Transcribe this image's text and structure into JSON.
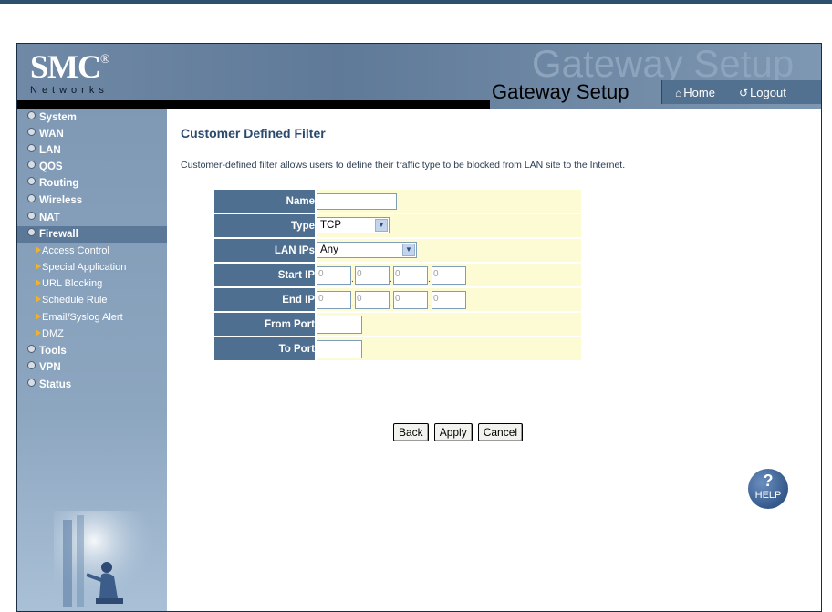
{
  "header": {
    "brand": "SMC",
    "brand_reg": "®",
    "brand_sub": "Networks",
    "watermark": "Gateway Setup",
    "title": "Gateway Setup",
    "home_label": "Home",
    "logout_label": "Logout"
  },
  "sidebar": {
    "items": [
      {
        "label": "System"
      },
      {
        "label": "WAN"
      },
      {
        "label": "LAN"
      },
      {
        "label": "QOS"
      },
      {
        "label": "Routing"
      },
      {
        "label": "Wireless"
      },
      {
        "label": "NAT"
      },
      {
        "label": "Firewall"
      },
      {
        "label": "Tools"
      },
      {
        "label": "VPN"
      },
      {
        "label": "Status"
      }
    ],
    "firewall_sub": [
      {
        "label": "Access Control"
      },
      {
        "label": "Special Application"
      },
      {
        "label": "URL Blocking"
      },
      {
        "label": "Schedule Rule"
      },
      {
        "label": "Email/Syslog Alert"
      },
      {
        "label": "DMZ"
      }
    ]
  },
  "main": {
    "title": "Customer Defined Filter",
    "description": "Customer-defined filter allows users to define their traffic type to be blocked from LAN site to the Internet.",
    "form": {
      "name_label": "Name",
      "name_value": "",
      "type_label": "Type",
      "type_value": "TCP",
      "lan_ips_label": "LAN IPs",
      "lan_ips_value": "Any",
      "start_ip_label": "Start IP",
      "start_ip": [
        "0",
        "0",
        "0",
        "0"
      ],
      "end_ip_label": "End IP",
      "end_ip": [
        "0",
        "0",
        "0",
        "0"
      ],
      "from_port_label": "From Port",
      "from_port_value": "",
      "to_port_label": "To Port",
      "to_port_value": ""
    },
    "buttons": {
      "back": "Back",
      "apply": "Apply",
      "cancel": "Cancel"
    },
    "help_label": "HELP"
  }
}
